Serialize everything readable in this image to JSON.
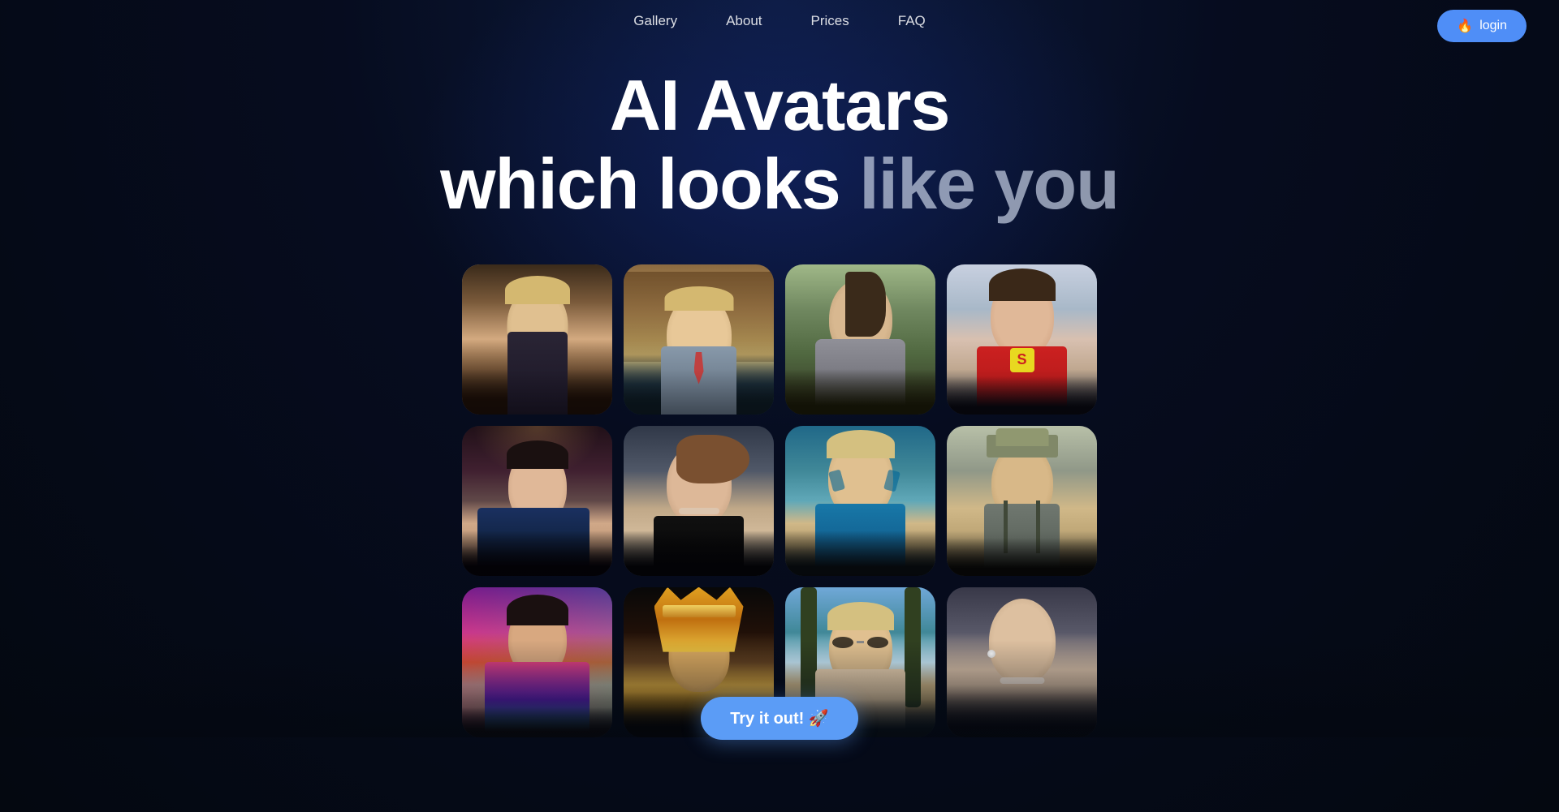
{
  "nav": {
    "links": [
      {
        "label": "Gallery",
        "id": "gallery"
      },
      {
        "label": "About",
        "id": "about"
      },
      {
        "label": "Prices",
        "id": "prices"
      },
      {
        "label": "FAQ",
        "id": "faq"
      }
    ],
    "login": {
      "label": "login",
      "icon": "🔥"
    }
  },
  "hero": {
    "line1": "AI Avatars",
    "line2_normal": "which looks ",
    "line2_muted": "like you"
  },
  "gallery": {
    "rows": [
      {
        "items": [
          {
            "id": "p1",
            "desc": "Young man in futuristic interior, blonde hair"
          },
          {
            "id": "p2",
            "desc": "Man in suit at desk with books, library background"
          },
          {
            "id": "p3",
            "desc": "Young woman in knight armor, outdoor"
          },
          {
            "id": "p4",
            "desc": "Young woman in superhero costume, Superman style"
          }
        ]
      },
      {
        "items": [
          {
            "id": "p5",
            "desc": "Woman in elegant blue dress, chandelier background"
          },
          {
            "id": "p6",
            "desc": "Woman with necklace, bokeh background"
          },
          {
            "id": "p7",
            "desc": "Man with face tattoos, blue teal background"
          },
          {
            "id": "p8",
            "desc": "Man with hat, casual, indoor"
          }
        ]
      },
      {
        "items": [
          {
            "id": "p9",
            "desc": "Woman in colorful Indian attire, neon lights"
          },
          {
            "id": "p10",
            "desc": "Person with ornate golden Aztec/Egyptian headdress"
          },
          {
            "id": "p11",
            "desc": "Man with sunglasses, palm trees, summer"
          },
          {
            "id": "p12",
            "desc": "Woman with pearl earring and necklace, close up"
          }
        ]
      }
    ]
  },
  "cta": {
    "label": "Try it out! 🚀"
  }
}
